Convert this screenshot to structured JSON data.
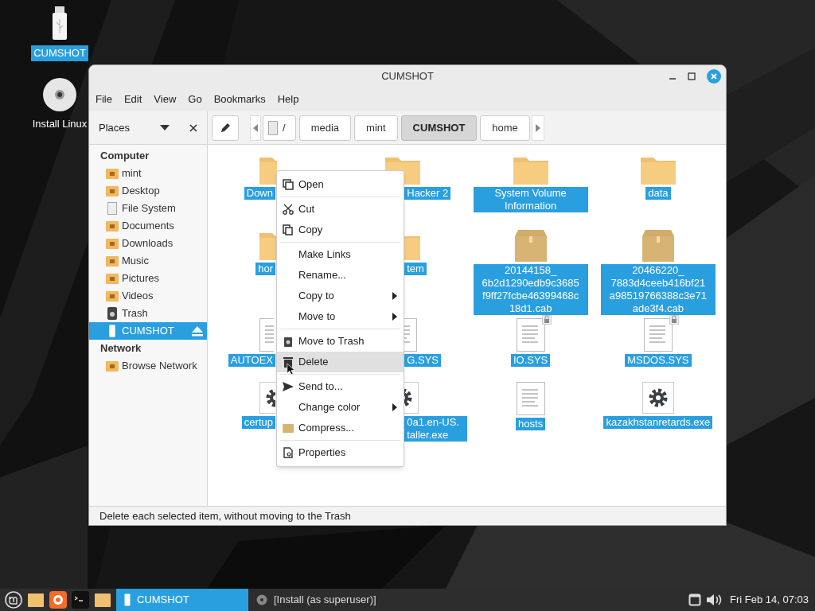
{
  "desktop_icons": [
    {
      "label": "CUMSHOT",
      "kind": "usb",
      "selected": true
    },
    {
      "label": "Install Linux",
      "kind": "disc",
      "selected": false
    }
  ],
  "window": {
    "title": "CUMSHOT",
    "menu": [
      "File",
      "Edit",
      "View",
      "Go",
      "Bookmarks",
      "Help"
    ],
    "sidebar": {
      "header": "Places",
      "sections": [
        {
          "title": "Computer",
          "items": [
            {
              "label": "mint",
              "kind": "folder",
              "selected": false
            },
            {
              "label": "Desktop",
              "kind": "folder",
              "selected": false
            },
            {
              "label": "File System",
              "kind": "drive",
              "selected": false
            },
            {
              "label": "Documents",
              "kind": "folder",
              "selected": false
            },
            {
              "label": "Downloads",
              "kind": "folder",
              "selected": false
            },
            {
              "label": "Music",
              "kind": "folder",
              "selected": false
            },
            {
              "label": "Pictures",
              "kind": "folder",
              "selected": false
            },
            {
              "label": "Videos",
              "kind": "folder",
              "selected": false
            },
            {
              "label": "Trash",
              "kind": "trash",
              "selected": false
            },
            {
              "label": "CUMSHOT",
              "kind": "usb",
              "selected": true,
              "eject": true
            }
          ]
        },
        {
          "title": "Network",
          "items": [
            {
              "label": "Browse Network",
              "kind": "folder",
              "selected": false
            }
          ]
        }
      ]
    },
    "path": [
      {
        "label": "/",
        "kind": "root",
        "selected": false
      },
      {
        "label": "media",
        "kind": "dir",
        "selected": false
      },
      {
        "label": "mint",
        "kind": "dir",
        "selected": false
      },
      {
        "label": "CUMSHOT",
        "kind": "dir",
        "selected": true
      },
      {
        "label": "home",
        "kind": "dir",
        "selected": false
      }
    ],
    "files": [
      {
        "label": "Down",
        "kind": "folder",
        "selected": true
      },
      {
        "label": "Hacker 2",
        "kind": "folder",
        "selected": true
      },
      {
        "label": "System Volume Information",
        "kind": "folder",
        "selected": true
      },
      {
        "label": "data",
        "kind": "folder",
        "selected": true
      },
      {
        "label": "hor",
        "kind": "folder",
        "selected": true
      },
      {
        "label": "tem",
        "kind": "folder",
        "selected": true
      },
      {
        "label": "20144158_ 6b2d1290edb9c3685 f9ff27fcbe46399468c 18d1.cab",
        "kind": "archive",
        "selected": true
      },
      {
        "label": "20466220_ 7883d4ceeb416bf21 a98519766388c3e71 ade3f4.cab",
        "kind": "archive",
        "selected": true
      },
      {
        "label": "AUTOEX",
        "kind": "document",
        "selected": true
      },
      {
        "label": "G.SYS",
        "kind": "document",
        "selected": true
      },
      {
        "label": "IO.SYS",
        "kind": "document",
        "selected": true,
        "locked": true
      },
      {
        "label": "MSDOS.SYS",
        "kind": "document",
        "selected": true,
        "locked": true
      },
      {
        "label": "certup",
        "kind": "program",
        "selected": true
      },
      {
        "label": "0a1.en-US. taller.exe",
        "kind": "program",
        "selected": true
      },
      {
        "label": "hosts",
        "kind": "document",
        "selected": true
      },
      {
        "label": "kazakhstanretards.exe",
        "kind": "program",
        "selected": true
      }
    ],
    "context_menu": [
      {
        "kind": "item",
        "label": "Open",
        "highlighted": false
      },
      {
        "kind": "separator"
      },
      {
        "kind": "item",
        "label": "Cut",
        "highlighted": false
      },
      {
        "kind": "item",
        "label": "Copy",
        "highlighted": false
      },
      {
        "kind": "separator"
      },
      {
        "kind": "item",
        "label": "Make Links",
        "highlighted": false
      },
      {
        "kind": "item",
        "label": "Rename...",
        "highlighted": false
      },
      {
        "kind": "item",
        "label": "Copy to",
        "highlighted": false,
        "submenu": true
      },
      {
        "kind": "item",
        "label": "Move to",
        "highlighted": false,
        "submenu": true
      },
      {
        "kind": "separator"
      },
      {
        "kind": "item",
        "label": "Move to Trash",
        "highlighted": false
      },
      {
        "kind": "item",
        "label": "Delete",
        "highlighted": true
      },
      {
        "kind": "separator"
      },
      {
        "kind": "item",
        "label": "Send to...",
        "highlighted": false
      },
      {
        "kind": "item",
        "label": "Change color",
        "highlighted": false,
        "submenu": true
      },
      {
        "kind": "item",
        "label": "Compress...",
        "highlighted": false
      },
      {
        "kind": "separator"
      },
      {
        "kind": "item",
        "label": "Properties",
        "highlighted": false
      }
    ],
    "status": "Delete each selected item, without moving to the Trash"
  },
  "taskbar": {
    "launchers": [
      {
        "kind": "menu"
      },
      {
        "kind": "folder"
      },
      {
        "kind": "browser"
      },
      {
        "kind": "terminal"
      },
      {
        "kind": "folder"
      }
    ],
    "windows": [
      {
        "label": "CUMSHOT",
        "kind": "usb",
        "selected": true
      },
      {
        "label": "[Install (as superuser)]",
        "kind": "installer",
        "selected": false
      }
    ],
    "clock": "Fri Feb 14, 07:03"
  }
}
